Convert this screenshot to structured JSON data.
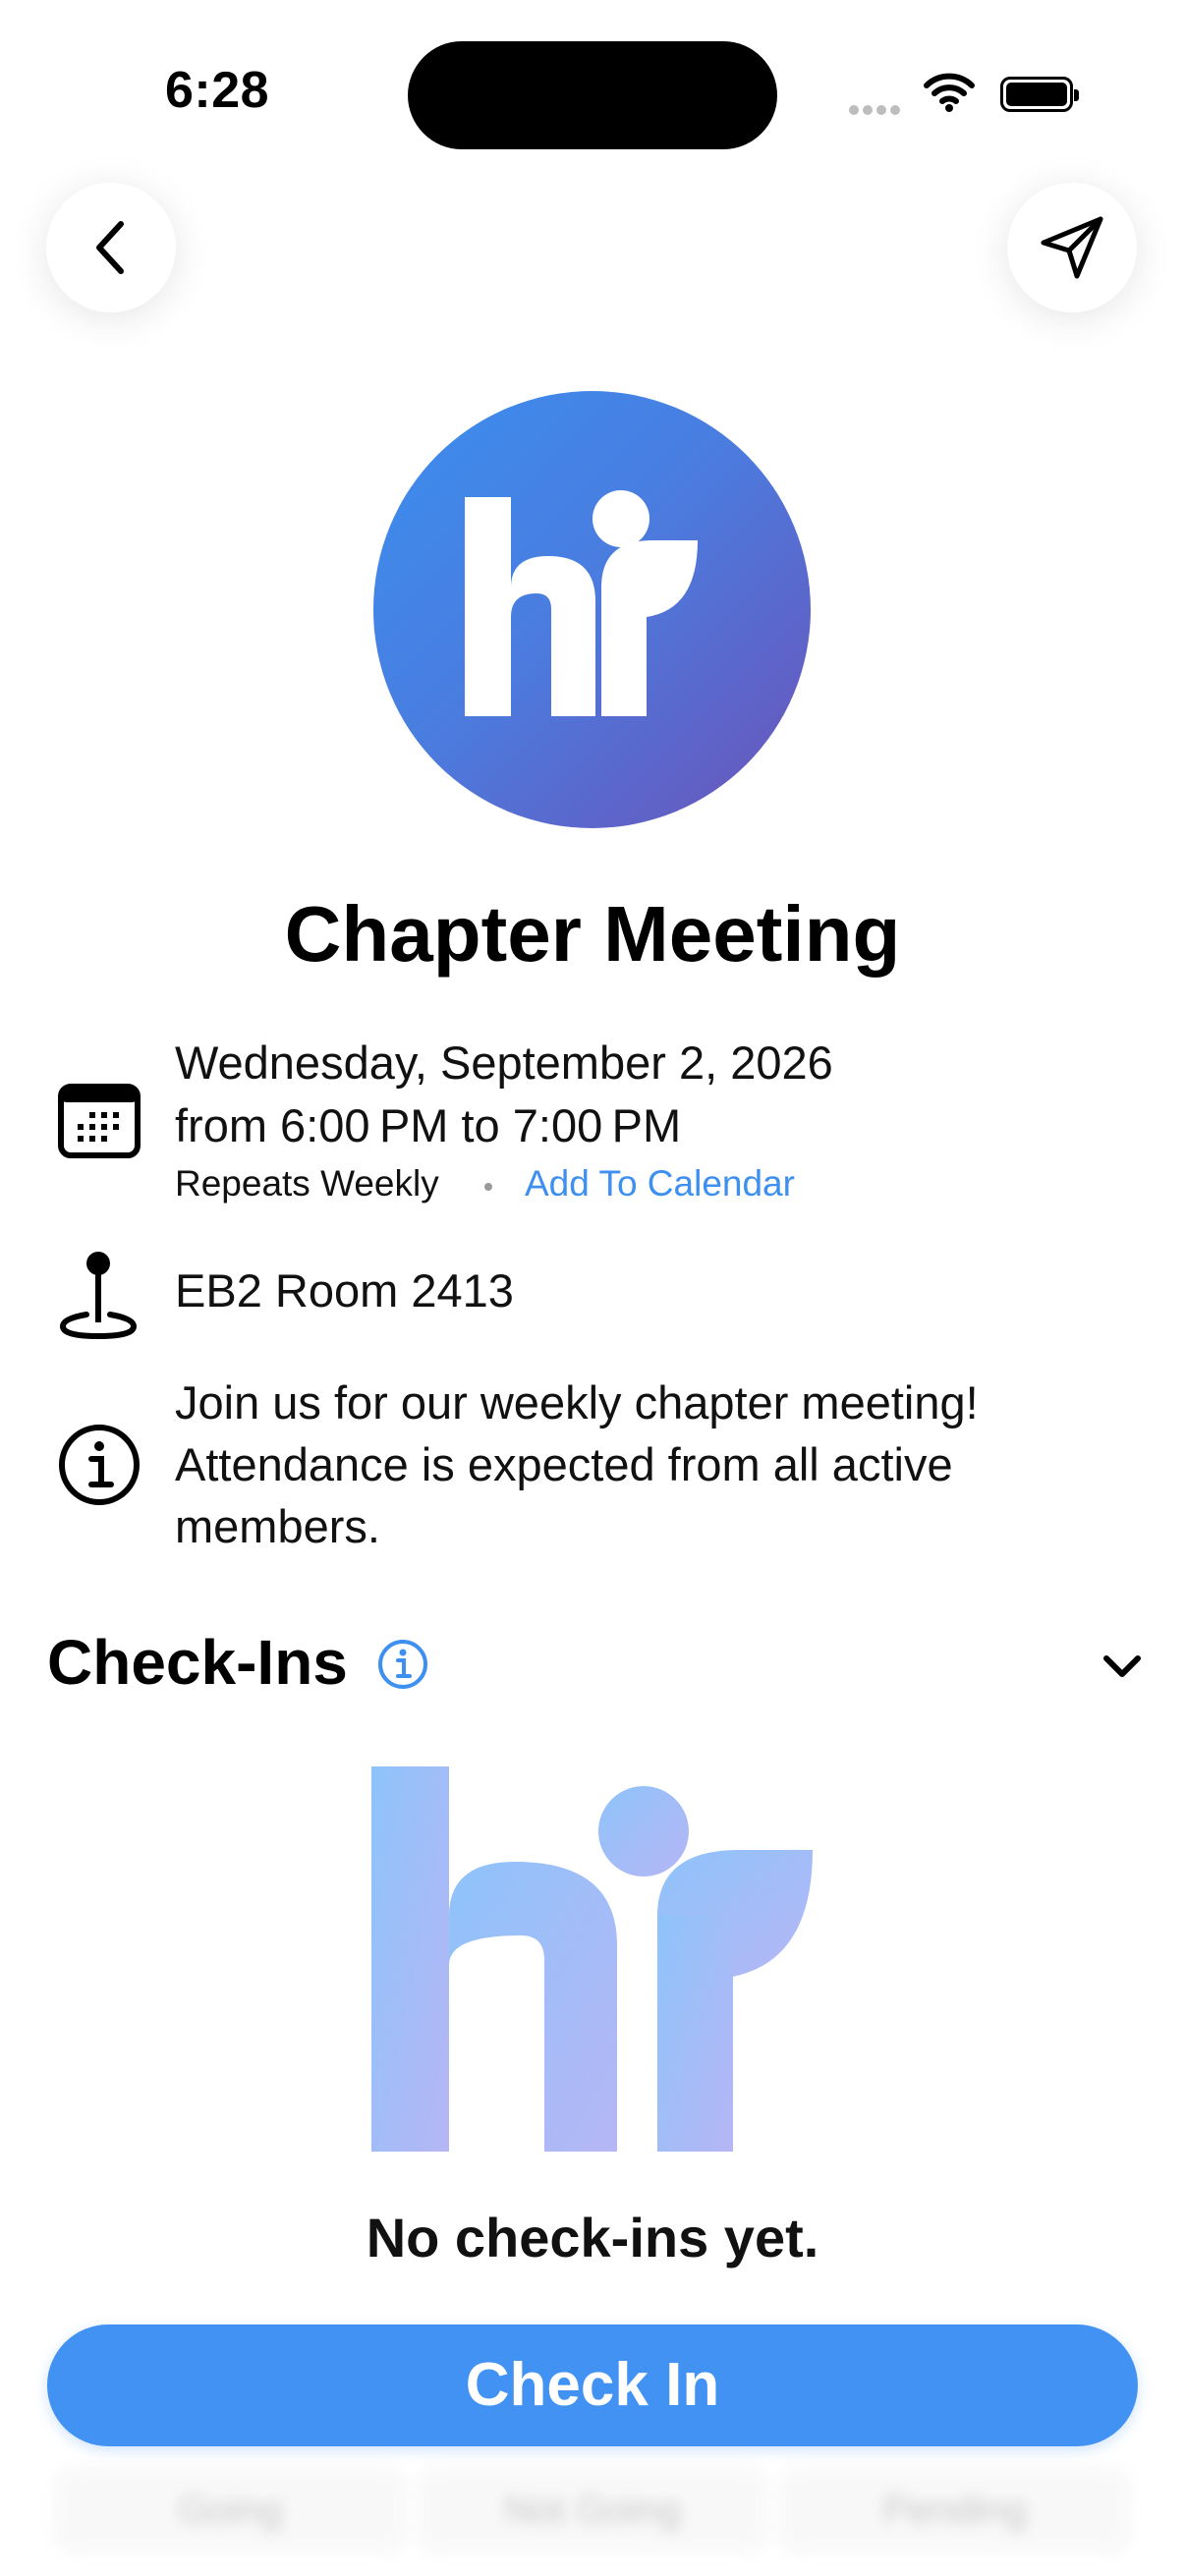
{
  "status_bar": {
    "time": "6:28"
  },
  "event": {
    "title": "Chapter Meeting",
    "date_line": "Wednesday, September 2, 2026",
    "time_line": "from 6:00 PM to 7:00 PM",
    "repeat": "Repeats Weekly",
    "add_to_calendar": "Add To Calendar",
    "location": "EB2 Room 2413",
    "description_lines": [
      "Join us for our weekly chapter meeting!",
      "Attendance is expected from all active",
      "members."
    ]
  },
  "checkins": {
    "title": "Check-Ins",
    "empty_text": "No check-ins yet."
  },
  "tabs": [
    "Going",
    "Not Going",
    "Pending"
  ],
  "actions": {
    "check_in": "Check In"
  },
  "icons": {
    "back": "chevron-left-icon",
    "share": "paper-plane-icon",
    "calendar": "calendar-icon",
    "location": "map-pin-icon",
    "info": "info-circle-icon",
    "expand": "chevron-down-icon"
  },
  "colors": {
    "accent": "#4292f4",
    "link": "#3d8ff0"
  }
}
